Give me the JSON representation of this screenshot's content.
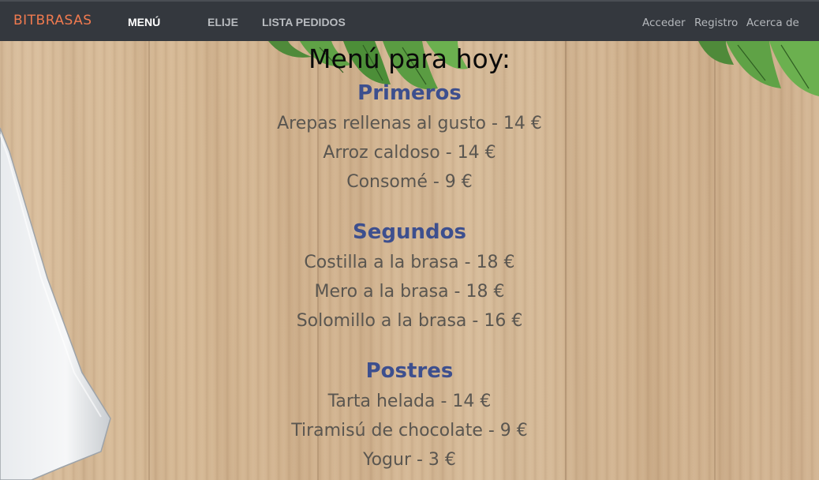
{
  "navbar": {
    "brand": "BITBRASAS",
    "links": [
      "MENÚ",
      "ELIJE",
      "LISTA PEDIDOS"
    ],
    "right_links": [
      "Acceder",
      "Registro",
      "Acerca de"
    ]
  },
  "colors": {
    "navbar_bg": "#34383e",
    "brand": "#f07a4f",
    "nav_active": "#ffffff",
    "nav_inactive": "#b9bcc0",
    "nav_right": "#b5b8bc",
    "section_title": "#3d4f8e",
    "dish_text": "#5a5650",
    "title_text": "#0a0a0a"
  },
  "menu": {
    "title": "Menú para hoy:",
    "sections": [
      {
        "title": "Primeros",
        "items": [
          "Arepas rellenas al gusto - 14 €",
          "Arroz caldoso - 14 €",
          "Consomé - 9 €"
        ]
      },
      {
        "title": "Segundos",
        "items": [
          "Costilla a la brasa - 18 €",
          "Mero a la brasa - 18 €",
          "Solomillo a la brasa - 16 €"
        ]
      },
      {
        "title": "Postres",
        "items": [
          "Tarta helada - 14 €",
          "Tiramisú de chocolate - 9 €",
          "Yogur - 3 €"
        ]
      }
    ]
  }
}
